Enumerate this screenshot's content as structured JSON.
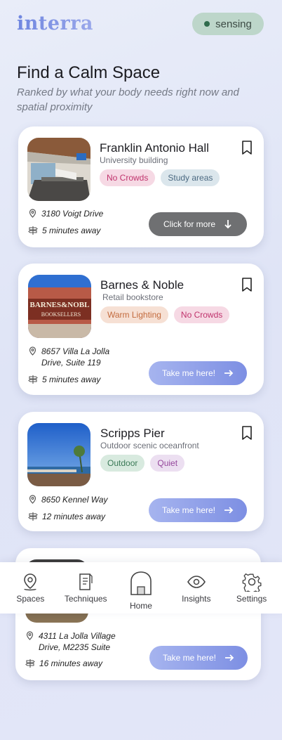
{
  "header": {
    "logo": "interra",
    "status": "sensing"
  },
  "page": {
    "title": "Find a Calm Space",
    "subtitle": "Ranked by what your body needs right now and spatial proximity"
  },
  "cards": [
    {
      "name": "Franklin Antonio Hall",
      "type": "University building",
      "tags": [
        "No Crowds",
        "Study areas"
      ],
      "address": "3180 Voigt Drive",
      "time": "5 minutes away",
      "button": "Click for more"
    },
    {
      "name": "Barnes & Noble",
      "type": "Retail bookstore",
      "tags": [
        "Warm Lighting",
        "No Crowds"
      ],
      "address": "8657 Villa La Jolla Drive, Suite 119",
      "time": "5 minutes away",
      "button": "Take me here!",
      "image_text": "BARNES&NOBLE BOOKSELLERS"
    },
    {
      "name": "Scripps Pier",
      "type": "Outdoor scenic oceanfront",
      "tags": [
        "Outdoor",
        "Quiet"
      ],
      "address": "8650 Kennel Way",
      "time": "12 minutes away",
      "button": "Take me here!"
    },
    {
      "address": "4311 La Jolla Village Drive, M2235 Suite",
      "time": "16 minutes away",
      "button": "Take me here!"
    }
  ],
  "nav": [
    {
      "label": "Spaces",
      "icon": "location-pin-icon"
    },
    {
      "label": "Techniques",
      "icon": "notes-icon"
    },
    {
      "label": "Home",
      "icon": "home-icon"
    },
    {
      "label": "Insights",
      "icon": "eye-icon"
    },
    {
      "label": "Settings",
      "icon": "gear-icon"
    }
  ],
  "colors": {
    "accent": "#7d8fe3",
    "sensing_bg": "#bdd6ca"
  }
}
